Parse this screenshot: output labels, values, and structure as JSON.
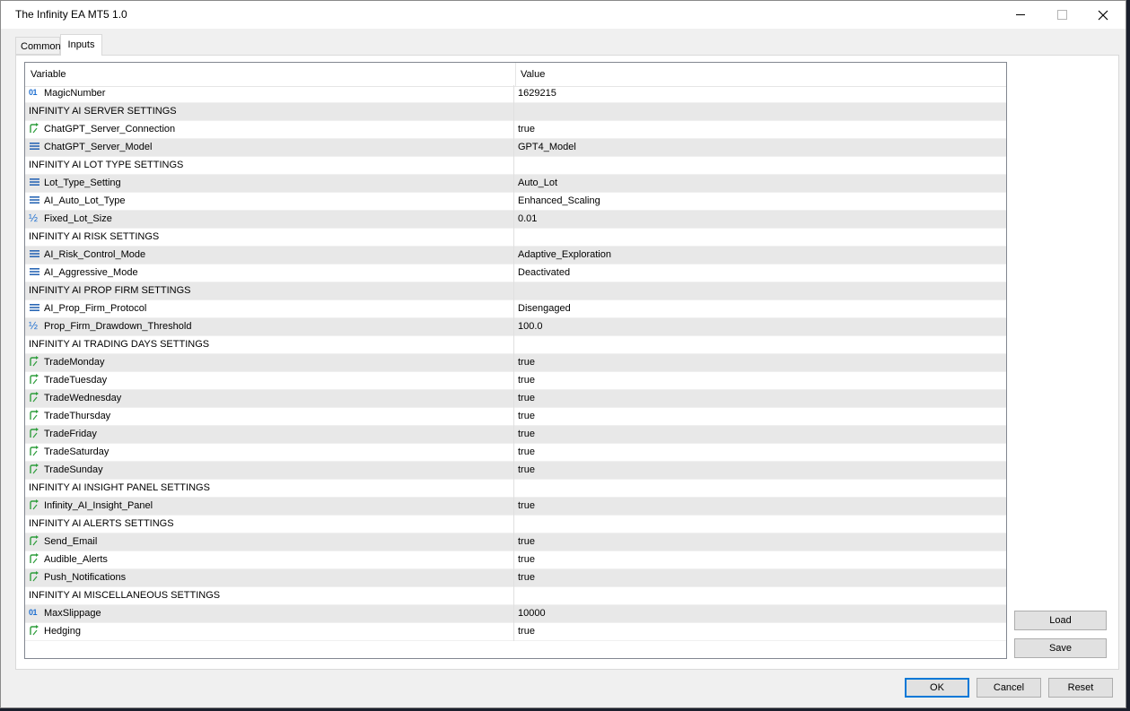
{
  "window": {
    "title": "The Infinity EA MT5 1.0"
  },
  "tabs": [
    {
      "label": "Common"
    },
    {
      "label": "Inputs"
    }
  ],
  "grid": {
    "headers": {
      "variable": "Variable",
      "value": "Value"
    },
    "rows": [
      {
        "type": "int",
        "variable": "MagicNumber",
        "value": "1629215"
      },
      {
        "type": "section",
        "variable": "INFINITY AI SERVER SETTINGS",
        "value": ""
      },
      {
        "type": "bool",
        "variable": "ChatGPT_Server_Connection",
        "value": "true"
      },
      {
        "type": "enum",
        "variable": "ChatGPT_Server_Model",
        "value": "GPT4_Model"
      },
      {
        "type": "section",
        "variable": "INFINITY AI LOT TYPE SETTINGS",
        "value": ""
      },
      {
        "type": "enum",
        "variable": "Lot_Type_Setting",
        "value": "Auto_Lot"
      },
      {
        "type": "enum",
        "variable": "AI_Auto_Lot_Type",
        "value": "Enhanced_Scaling"
      },
      {
        "type": "double",
        "variable": "Fixed_Lot_Size",
        "value": "0.01"
      },
      {
        "type": "section",
        "variable": "INFINITY AI RISK SETTINGS",
        "value": ""
      },
      {
        "type": "enum",
        "variable": "AI_Risk_Control_Mode",
        "value": "Adaptive_Exploration"
      },
      {
        "type": "enum",
        "variable": "AI_Aggressive_Mode",
        "value": "Deactivated"
      },
      {
        "type": "section",
        "variable": "INFINITY AI PROP FIRM SETTINGS",
        "value": ""
      },
      {
        "type": "enum",
        "variable": "AI_Prop_Firm_Protocol",
        "value": "Disengaged"
      },
      {
        "type": "double",
        "variable": "Prop_Firm_Drawdown_Threshold",
        "value": "100.0"
      },
      {
        "type": "section",
        "variable": "INFINITY AI TRADING DAYS SETTINGS",
        "value": ""
      },
      {
        "type": "bool",
        "variable": "TradeMonday",
        "value": "true"
      },
      {
        "type": "bool",
        "variable": "TradeTuesday",
        "value": "true"
      },
      {
        "type": "bool",
        "variable": "TradeWednesday",
        "value": "true"
      },
      {
        "type": "bool",
        "variable": "TradeThursday",
        "value": "true"
      },
      {
        "type": "bool",
        "variable": "TradeFriday",
        "value": "true"
      },
      {
        "type": "bool",
        "variable": "TradeSaturday",
        "value": "true"
      },
      {
        "type": "bool",
        "variable": "TradeSunday",
        "value": "true"
      },
      {
        "type": "section",
        "variable": "INFINITY AI INSIGHT PANEL SETTINGS",
        "value": ""
      },
      {
        "type": "bool",
        "variable": "Infinity_AI_Insight_Panel",
        "value": "true"
      },
      {
        "type": "section",
        "variable": "INFINITY AI ALERTS SETTINGS",
        "value": ""
      },
      {
        "type": "bool",
        "variable": "Send_Email",
        "value": "true"
      },
      {
        "type": "bool",
        "variable": "Audible_Alerts",
        "value": "true"
      },
      {
        "type": "bool",
        "variable": "Push_Notifications",
        "value": "true"
      },
      {
        "type": "section",
        "variable": "INFINITY AI MISCELLANEOUS SETTINGS",
        "value": ""
      },
      {
        "type": "int",
        "variable": "MaxSlippage",
        "value": "10000"
      },
      {
        "type": "bool",
        "variable": "Hedging",
        "value": "true"
      }
    ]
  },
  "buttons": {
    "load": "Load",
    "save": "Save",
    "ok": "OK",
    "cancel": "Cancel",
    "reset": "Reset"
  },
  "icons": {
    "int": "int-type-icon",
    "bool": "bool-type-icon",
    "enum": "enum-type-icon",
    "double": "double-type-icon"
  },
  "colors": {
    "accent": "#0078d7",
    "bool_icon": "#2e9d3c",
    "enum_icon": "#2a67b5",
    "num_icon": "#1e6fd0"
  }
}
